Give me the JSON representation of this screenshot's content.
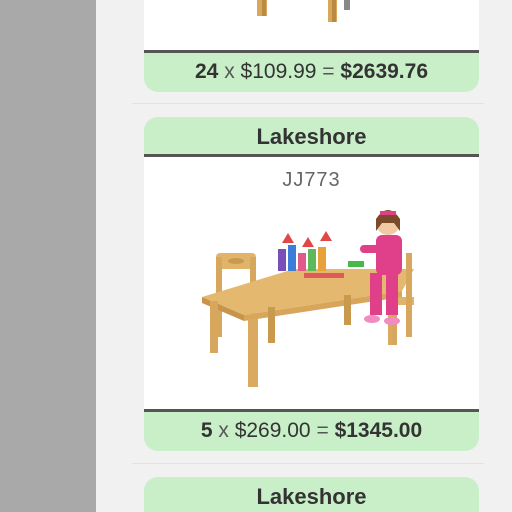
{
  "cards": [
    {
      "footer": {
        "qty": "24",
        "x": "x",
        "price": "$109.99",
        "eq": "=",
        "total": "$2639.76"
      }
    },
    {
      "brand": "Lakeshore",
      "sku": "JJ773",
      "image_icon": "kids-table-product-photo",
      "footer": {
        "qty": "5",
        "x": "x",
        "price": "$269.00",
        "eq": "=",
        "total": "$1345.00"
      }
    },
    {
      "brand": "Lakeshore"
    }
  ],
  "colors": {
    "header_bg": "#c8efc8",
    "footer_bg": "#c8efc8",
    "divider": "#555555",
    "sidebar": "#a9a9a9",
    "page_bg": "#f1f1f1"
  }
}
